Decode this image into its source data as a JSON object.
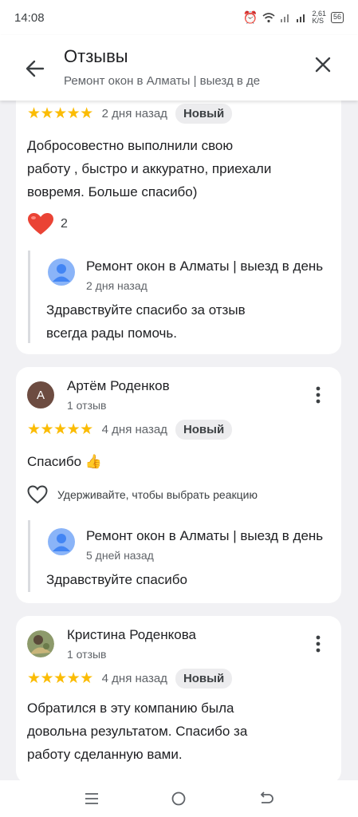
{
  "status_bar": {
    "time": "14:08",
    "speed_value": "2,61",
    "speed_unit": "K/S",
    "battery": "56"
  },
  "header": {
    "title": "Отзывы",
    "subtitle": "Ремонт окон в Алматы | выезд в де"
  },
  "reviews": [
    {
      "stars": "★★★★★",
      "date": "2 дня назад",
      "badge": "Новый",
      "text_lines": [
        "Добросовестно выполнили свою",
        "работу , быстро и аккуратно, приехали",
        "вовремя. Больше спасибо)"
      ],
      "reaction_count": "2",
      "reply": {
        "owner": "Ремонт окон в Алматы | выезд в день",
        "date": "2 дня назад",
        "text_lines": [
          "Здравствуйте спасибо за отзыв",
          "всегда рады помочь."
        ]
      }
    },
    {
      "avatar_letter": "А",
      "avatar_color": "#6d4c41",
      "author": "Артём Роденков",
      "review_count": "1 отзыв",
      "stars": "★★★★★",
      "date": "4 дня назад",
      "badge": "Новый",
      "text": "Спасибо 👍",
      "reaction_hint": "Удерживайте, чтобы выбрать реакцию",
      "reply": {
        "owner": "Ремонт окон в Алматы | выезд в день",
        "date": "5 дней назад",
        "text": "Здравствуйте спасибо"
      }
    },
    {
      "author": "Кристина Роденкова",
      "review_count": "1 отзыв",
      "stars": "★★★★★",
      "date": "4 дня назад",
      "badge": "Новый",
      "text_lines": [
        "Обратился в эту компанию была",
        "довольна результатом. Спасибо за",
        "работу сделанную вами."
      ]
    }
  ],
  "colors": {
    "star": "#fbbc04",
    "heart_filled": "#ea4335",
    "owner_avatar": "#8ab4f8"
  },
  "icons": [
    "back-arrow-icon",
    "close-icon",
    "more-vert-icon",
    "heart-icon",
    "heart-outline-icon",
    "menu-icon",
    "home-icon",
    "back-icon"
  ]
}
